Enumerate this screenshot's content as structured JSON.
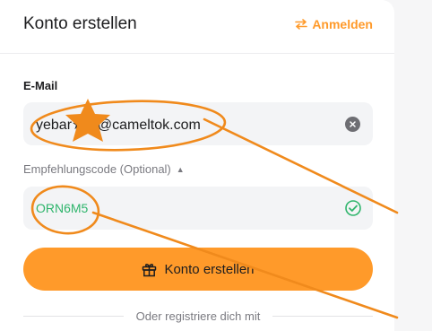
{
  "header": {
    "title": "Konto erstellen",
    "login_label": "Anmelden"
  },
  "form": {
    "email_label": "E-Mail",
    "email_value": "yebar★•4@cameltok.com",
    "referral_toggle_label": "Empfehlungscode (Optional)",
    "referral_value": "ORN6M5",
    "submit_label": "Konto erstellen",
    "alt_signup_label": "Oder registriere dich mit"
  },
  "colors": {
    "accent": "#ff9a2a",
    "success": "#2fb56c",
    "annotation": "#f08a1c"
  },
  "icons": [
    "swap-arrows-icon",
    "clear-icon",
    "check-circle-icon",
    "gift-icon",
    "caret-up-icon"
  ]
}
